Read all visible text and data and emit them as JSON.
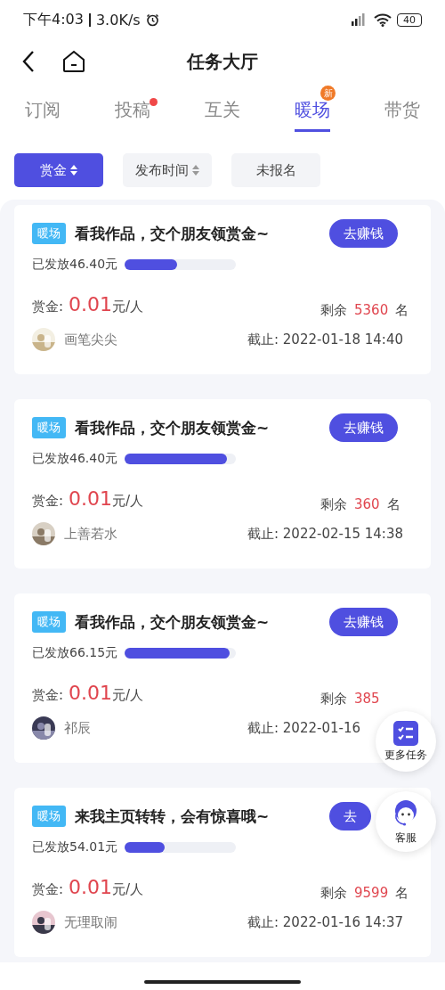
{
  "status_bar": {
    "time": "下午4:03",
    "speed": "3.0K/s",
    "battery": "40"
  },
  "header": {
    "title": "任务大厅"
  },
  "tabs": [
    {
      "label": "订阅",
      "selected": false,
      "dot": false
    },
    {
      "label": "投稿",
      "selected": false,
      "dot": true
    },
    {
      "label": "互关",
      "selected": false,
      "dot": false
    },
    {
      "label": "暖场",
      "selected": true,
      "dot": false,
      "badge": "新"
    },
    {
      "label": "带货",
      "selected": false,
      "dot": false
    }
  ],
  "filters": [
    {
      "label": "赏金",
      "selected": true,
      "sortable": true
    },
    {
      "label": "发布时间",
      "selected": false,
      "sortable": true
    },
    {
      "label": "未报名",
      "selected": false,
      "sortable": false
    }
  ],
  "tasks": [
    {
      "tag": "暖场",
      "title": "看我作品，交个朋友领赏金~",
      "button": "去赚钱",
      "paid": "已发放46.40元",
      "level": 0.47,
      "reward_label": "赏金:",
      "reward": "0.01",
      "reward_unit": "元/人",
      "remaining_label": "剩余",
      "remaining": "5360",
      "remaining_unit": "名",
      "user": "画笔尖尖",
      "deadline": "截止: 2022-01-18 14:40"
    },
    {
      "tag": "暖场",
      "title": "看我作品，交个朋友领赏金~",
      "button": "去赚钱",
      "paid": "已发放46.40元",
      "level": 0.92,
      "reward_label": "赏金:",
      "reward": "0.01",
      "reward_unit": "元/人",
      "remaining_label": "剩余",
      "remaining": "360",
      "remaining_unit": "名",
      "user": "上善若水",
      "deadline": "截止: 2022-02-15 14:38"
    },
    {
      "tag": "暖场",
      "title": "看我作品，交个朋友领赏金~",
      "button": "去赚钱",
      "paid": "已发放66.15元",
      "level": 0.94,
      "reward_label": "赏金:",
      "reward": "0.01",
      "reward_unit": "元/人",
      "remaining_label": "剩余",
      "remaining": "385",
      "user": "祁辰",
      "deadline": "截止: 2022-01-16"
    },
    {
      "tag": "暖场",
      "title": "来我主页转转，会有惊喜哦~",
      "button": "去",
      "paid": "已发放54.01元",
      "level": 0.36,
      "reward_label": "赏金:",
      "reward": "0.01",
      "reward_unit": "元/人",
      "remaining_label": "剩余",
      "remaining": "9599",
      "remaining_unit": "名",
      "user": "无理取闹",
      "deadline": "截止: 2022-01-16 14:37"
    }
  ],
  "floating_buttons": [
    {
      "label": "更多任务",
      "kind": "tasks"
    },
    {
      "label": "客服",
      "kind": "service"
    }
  ]
}
